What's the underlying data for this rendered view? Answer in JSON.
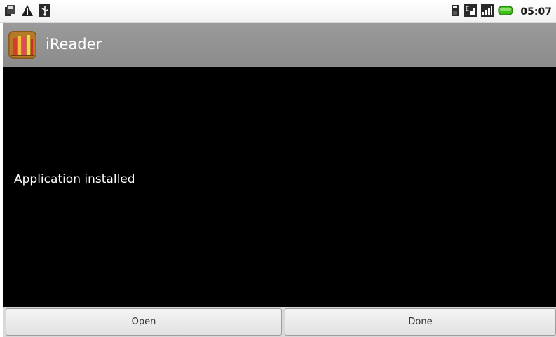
{
  "status_bar": {
    "left_icons": [
      "phone-storage-icon",
      "warning-icon",
      "usb-icon"
    ],
    "right_icons": [
      "sd-card-icon",
      "data-signal-icon",
      "cell-signal-icon",
      "battery-icon"
    ],
    "time": "05:07"
  },
  "app": {
    "title": "iReader",
    "icon": "ireader-books-icon"
  },
  "content": {
    "message": "Application installed"
  },
  "buttons": {
    "open_label": "Open",
    "done_label": "Done"
  },
  "colors": {
    "title_bar": "#929292",
    "content_bg": "#000000",
    "battery": "#3fbf1a"
  }
}
